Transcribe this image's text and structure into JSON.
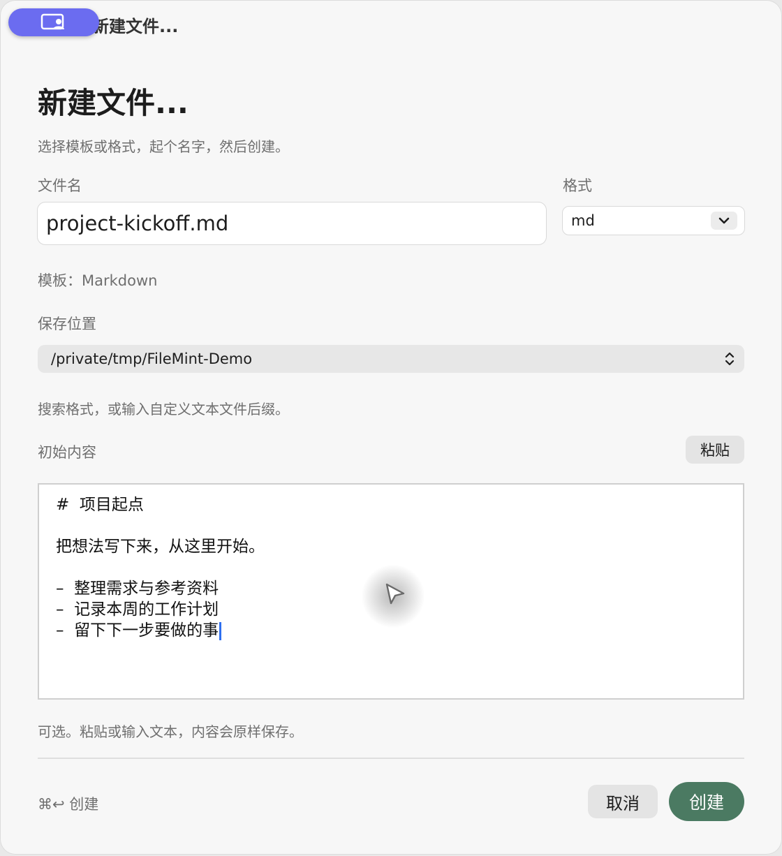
{
  "window": {
    "title": "新建文件..."
  },
  "dialog": {
    "heading": "新建文件...",
    "subtitle": "选择模板或格式，起个名字，然后创建。",
    "filename_label": "文件名",
    "filename_value": "project-kickoff.md",
    "format_label": "格式",
    "format_value": "md",
    "template_line": "模板：Markdown",
    "location_label": "保存位置",
    "location_value": "/private/tmp/FileMint-Demo",
    "format_hint": "搜索格式，或输入自定义文本文件后缀。",
    "content_label": "初始内容",
    "paste_label": "粘贴",
    "content_lines": [
      "#  项目起点",
      "",
      "把想法写下来，从这里开始。",
      "",
      "–  整理需求与参考资料",
      "–  记录本周的工作计划",
      "–  留下下一步要做的事"
    ],
    "content_hint": "可选。粘贴或输入文本，内容会原样保存。",
    "shortcut_hint": "⌘↩ 创建",
    "cancel_label": "取消",
    "create_label": "创建"
  },
  "icons": {
    "screen_share": "screen-share-icon",
    "format_chevron": "chevron-down-icon",
    "location_chevron": "up-down-chevron-icon",
    "pointer": "pointer-icon"
  },
  "colors": {
    "accent_purple": "#6b6cf0",
    "create_green": "#4b7a62",
    "caret_blue": "#2f6ff0",
    "background": "#f7f7f7"
  }
}
